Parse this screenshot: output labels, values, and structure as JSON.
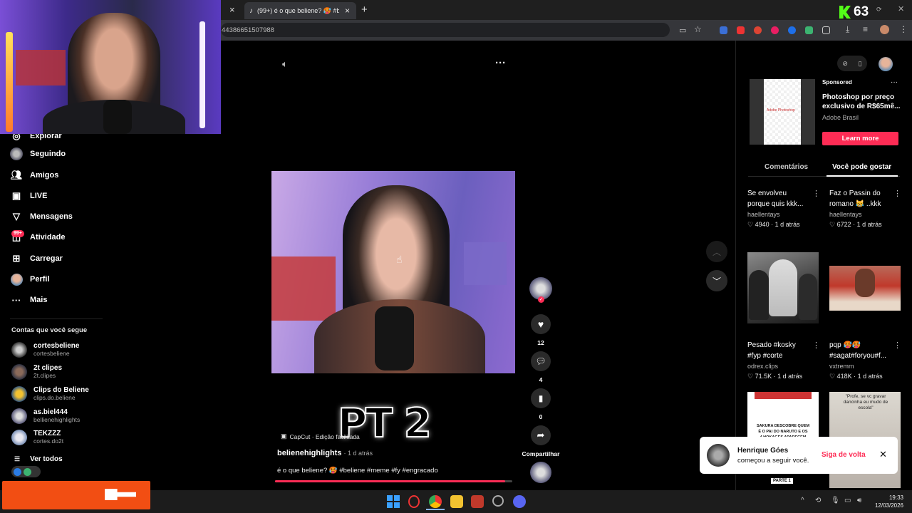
{
  "browser": {
    "tab_title": "(99+) é o que beliene? 🥵 #beli",
    "address": "44386651507988",
    "close_tab_glyph": "×",
    "new_tab_glyph": "+",
    "kick_viewers": "63"
  },
  "sidebar": {
    "explore_label": "Explorar",
    "items": [
      {
        "label": "Seguindo",
        "icon": "following-avatar-icon"
      },
      {
        "label": "Amigos",
        "icon": "friends-icon"
      },
      {
        "label": "LIVE",
        "icon": "live-icon"
      },
      {
        "label": "Mensagens",
        "icon": "messages-icon"
      },
      {
        "label": "Atividade",
        "icon": "activity-icon",
        "badge": "99+"
      },
      {
        "label": "Carregar",
        "icon": "upload-icon"
      },
      {
        "label": "Perfil",
        "icon": "profile-avatar-icon"
      },
      {
        "label": "Mais",
        "icon": "more-icon"
      }
    ],
    "following_header": "Contas que você segue",
    "accounts": [
      {
        "name": "cortesbeliene",
        "handle": "cortesbeliene"
      },
      {
        "name": "2t clipes",
        "handle": "2t.clipes"
      },
      {
        "name": "Clips do Beliene",
        "handle": "clips.do.beliene"
      },
      {
        "name": "as.biel444",
        "handle": "bellienehighlights"
      },
      {
        "name": "TEKZZZ",
        "handle": "cortes.do2t"
      }
    ],
    "see_all": "Ver todos"
  },
  "video": {
    "overlay_text": "PT 2",
    "capcut_label": "CapCut · Edição facilitada",
    "author": "belienehighlights",
    "posted": "· 1 d atrás",
    "caption": "é o que beliene? 🥵 #beliene #meme #fy #engracado",
    "likes": "12",
    "comments": "4",
    "saves": "0",
    "share_label": "Compartilhar",
    "progress": 0.97
  },
  "ad": {
    "sponsored": "Sponsored",
    "title_line1": "Photoshop por preço",
    "title_line2": "exclusivo de R$65mê...",
    "brand": "Adobe Brasil",
    "cta": "Learn more",
    "thumb_label": "Adobe Photoshop"
  },
  "panel_tabs": {
    "comments": "Comentários",
    "suggested": "Você pode gostar"
  },
  "suggested": [
    {
      "title1": "Se envolveu",
      "title2": "porque quis kkk...",
      "author": "haellentays",
      "stats": "♡ 4940 · 1 d atrás"
    },
    {
      "title1": "Faz o Passin do",
      "title2": "romano 😹 ..kkk",
      "author": "haellentays",
      "stats": "♡ 6722 · 1 d atrás"
    },
    {
      "title1": "Pesado #kosky",
      "title2": "#fyp #corte",
      "author": "odrex.clips",
      "stats": "♡ 71.5K · 1 d atrás"
    },
    {
      "title1": "pqp 🥵🥵",
      "title2": "#sagat#foryou#f...",
      "author": "vxtremm",
      "stats": "♡ 418K · 1 d atrás"
    }
  ],
  "thumb_texts": {
    "naruto_line1": "SAKURA DESCOBRE QUEM",
    "naruto_line2": "É O PAI DO NARUTO E OS",
    "naruto_line3": "4 HOKAGES APARECEM",
    "naruto_badge": "PARTE 1",
    "prof_text": "\"Profe, se vc gravar dancinha eu mudo de escola\""
  },
  "toast": {
    "name": "Henrique Góes",
    "message": "começou a seguir você.",
    "action": "Siga de volta"
  },
  "taskbar": {
    "time": "19:33",
    "date": "12/03/2026"
  },
  "colors": {
    "accent": "#fe2c55",
    "orange": "#f24e13",
    "kick_green": "#53fc18"
  }
}
